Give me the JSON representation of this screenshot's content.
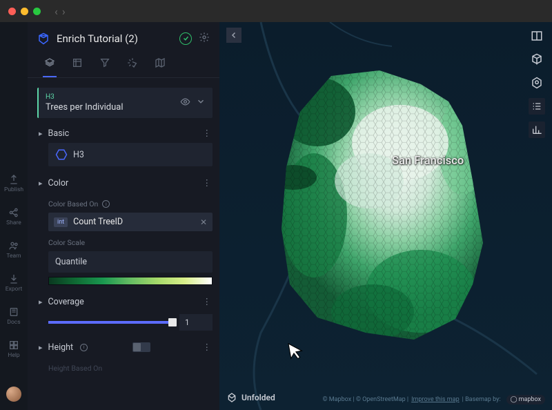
{
  "topbar": {},
  "sidebar": {
    "title": "Enrich Tutorial (2)",
    "layer": {
      "type": "H3",
      "name": "Trees per Individual"
    },
    "sections": {
      "basic": {
        "label": "Basic",
        "chip": "H3"
      },
      "color": {
        "label": "Color",
        "based_on_label": "Color Based On",
        "based_on_tag": "int",
        "based_on_value": "Count TreeID",
        "scale_label": "Color Scale",
        "scale_value": "Quantile"
      },
      "coverage": {
        "label": "Coverage",
        "value": "1",
        "pct": 100
      },
      "height": {
        "label": "Height",
        "based_on_label": "Height Based On"
      }
    }
  },
  "rail": {
    "items": [
      {
        "icon": "publish",
        "label": "Publish"
      },
      {
        "icon": "share",
        "label": "Share"
      },
      {
        "icon": "team",
        "label": "Team"
      },
      {
        "icon": "export",
        "label": "Export"
      },
      {
        "icon": "docs",
        "label": "Docs"
      },
      {
        "icon": "help",
        "label": "Help"
      }
    ]
  },
  "map": {
    "city_label": "San Francisco",
    "branding": "Unfolded",
    "attrib_prefix": "© Mapbox | © OpenStreetMap |",
    "attrib_improve": "Improve this map",
    "attrib_basemap": "| Basemap by:",
    "attrib_logo": "mapbox"
  },
  "colors": {
    "accent": "#5c6cff",
    "teal": "#5dd6a8"
  }
}
